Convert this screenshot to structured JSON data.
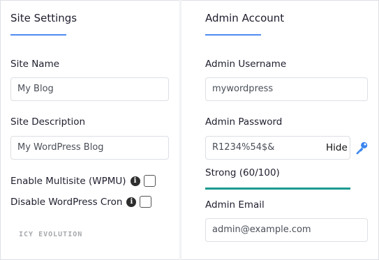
{
  "site_settings": {
    "title": "Site Settings",
    "site_name_label": "Site Name",
    "site_name_value": "My Blog",
    "site_description_label": "Site Description",
    "site_description_value": "My WordPress Blog",
    "multisite_label": "Enable Multisite (WPMU)",
    "multisite_checked": false,
    "disable_cron_label": "Disable WordPress Cron",
    "disable_cron_checked": false
  },
  "admin_account": {
    "title": "Admin Account",
    "username_label": "Admin Username",
    "username_value": "mywordpress",
    "password_label": "Admin Password",
    "password_value": "R1234%54$&",
    "hide_label": "Hide",
    "strength_text": "Strong (60/100)",
    "strength_fraction": 1.0,
    "email_label": "Admin Email",
    "email_value": "admin@example.com"
  },
  "icons": {
    "info": "info-icon",
    "key": "key-icon"
  },
  "colors": {
    "accent_underline": "#4f8cf2",
    "strength_strong": "#1b9a8f",
    "key_icon": "#3b86f0"
  },
  "watermark": "ICY EVOLUTION"
}
